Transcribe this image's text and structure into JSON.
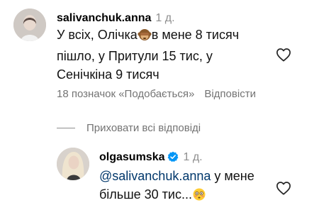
{
  "comments": [
    {
      "username": "salivanchuk.anna",
      "time": "1 д.",
      "text_part1": "У всіх, Олічка",
      "emoji": "see-no-evil-monkey",
      "text_part2": "в мене 8 тисяч пішло, у Притули 15 тис, у Сенічкіна 9 тисяч",
      "likes": "18 позначок «Подобається»",
      "reply_label": "Відповісти"
    }
  ],
  "replies_toggle": "Приховати всі відповіді",
  "reply": {
    "username": "olgasumska",
    "verified": true,
    "time": "1 д.",
    "mention": "@salivanchuk.anna",
    "text": " у мене більше 30 тис...",
    "emoji": "flushed-face"
  },
  "colors": {
    "muted": "#737373",
    "mention": "#00376b",
    "verified": "#0095f6"
  }
}
